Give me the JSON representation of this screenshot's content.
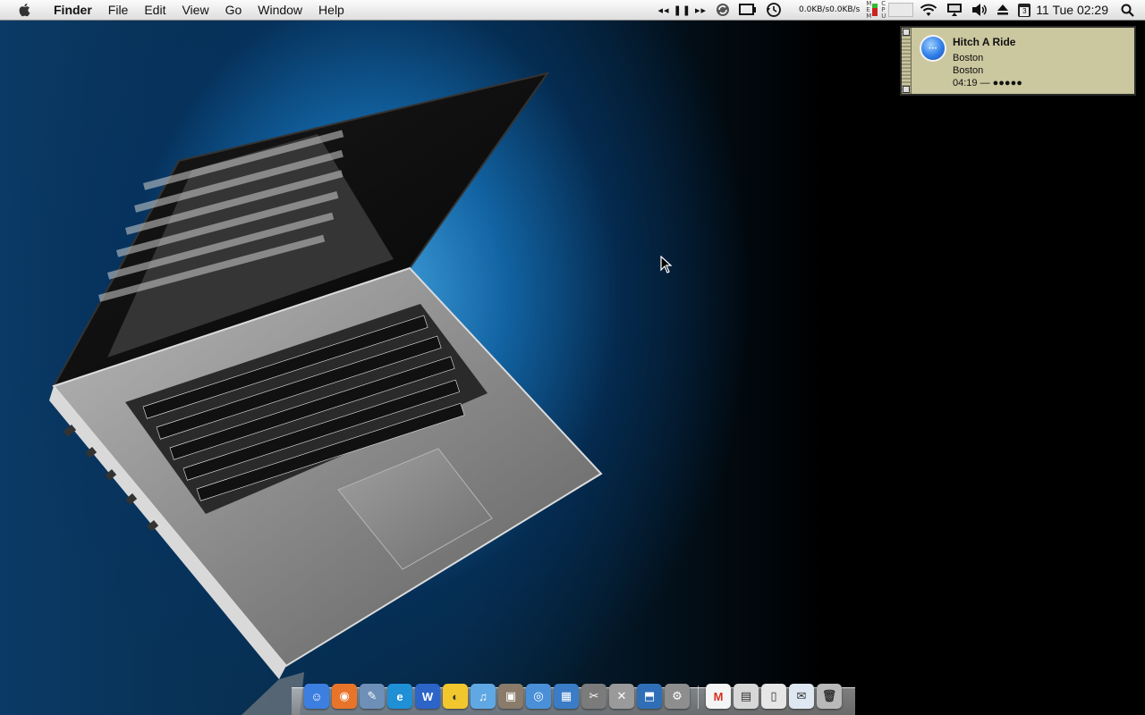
{
  "menubar": {
    "app_name": "Finder",
    "menus": [
      "File",
      "Edit",
      "View",
      "Go",
      "Window",
      "Help"
    ],
    "status_items": {
      "net_up": "0.0KB/s",
      "net_down": "0.0KB/s",
      "mem_label": "MEM",
      "cpu_label": "CPU",
      "calendar_day": "3",
      "clock": "11 Tue 02:29"
    }
  },
  "notification": {
    "title": "Hitch A Ride",
    "line1": "Boston",
    "line2": "Boston",
    "line3": "04:19 — ●●●●●",
    "icon_text": "···"
  },
  "dock": {
    "apps": [
      {
        "name": "Finder",
        "icon": "finder-icon",
        "color": "#3d7fe0",
        "glyph": "☺"
      },
      {
        "name": "Firefox",
        "icon": "firefox-icon",
        "color": "#e8742a",
        "glyph": "◉"
      },
      {
        "name": "Preview",
        "icon": "preview-icon",
        "color": "#6d8fb8",
        "glyph": "✎"
      },
      {
        "name": "Internet Explorer",
        "icon": "ie-icon",
        "color": "#1f8fd6",
        "glyph": "e"
      },
      {
        "name": "Word",
        "icon": "word-icon",
        "color": "#2c64c8",
        "glyph": "W"
      },
      {
        "name": "Cyberduck",
        "icon": "cyberduck-icon",
        "color": "#f2c72e",
        "glyph": "◐"
      },
      {
        "name": "iTunes",
        "icon": "itunes-icon",
        "color": "#5fa8e4",
        "glyph": "♫"
      },
      {
        "name": "iPhoto",
        "icon": "iphoto-icon",
        "color": "#8a7b6a",
        "glyph": "▣"
      },
      {
        "name": "Safari",
        "icon": "safari-icon",
        "color": "#4a90d8",
        "glyph": "◎"
      },
      {
        "name": "Dashboard",
        "icon": "dashboard-icon",
        "color": "#3a7cc6",
        "glyph": "▦"
      },
      {
        "name": "Utilities",
        "icon": "utilities-icon",
        "color": "#7b7b7b",
        "glyph": "✂"
      },
      {
        "name": "Script Editor",
        "icon": "script-editor-icon",
        "color": "#9a9a9a",
        "glyph": "✕"
      },
      {
        "name": "App Store",
        "icon": "appstore-icon",
        "color": "#2f6fb8",
        "glyph": "⬒"
      },
      {
        "name": "System Preferences",
        "icon": "system-preferences-icon",
        "color": "#8e8e8e",
        "glyph": "⚙"
      }
    ],
    "stacks": [
      {
        "name": "Gmail",
        "icon": "gmail-icon",
        "color": "#f4f4f4",
        "glyph": "M"
      },
      {
        "name": "Printer",
        "icon": "printer-icon",
        "color": "#d7d7d7",
        "glyph": "▤"
      },
      {
        "name": "Documents",
        "icon": "documents-icon",
        "color": "#e6e6e6",
        "glyph": "▯"
      },
      {
        "name": "Mail",
        "icon": "mail-icon",
        "color": "#dfe8f2",
        "glyph": "✉"
      },
      {
        "name": "Trash",
        "icon": "trash-icon",
        "color": "#b9b9b9",
        "glyph": "🗑"
      }
    ]
  }
}
